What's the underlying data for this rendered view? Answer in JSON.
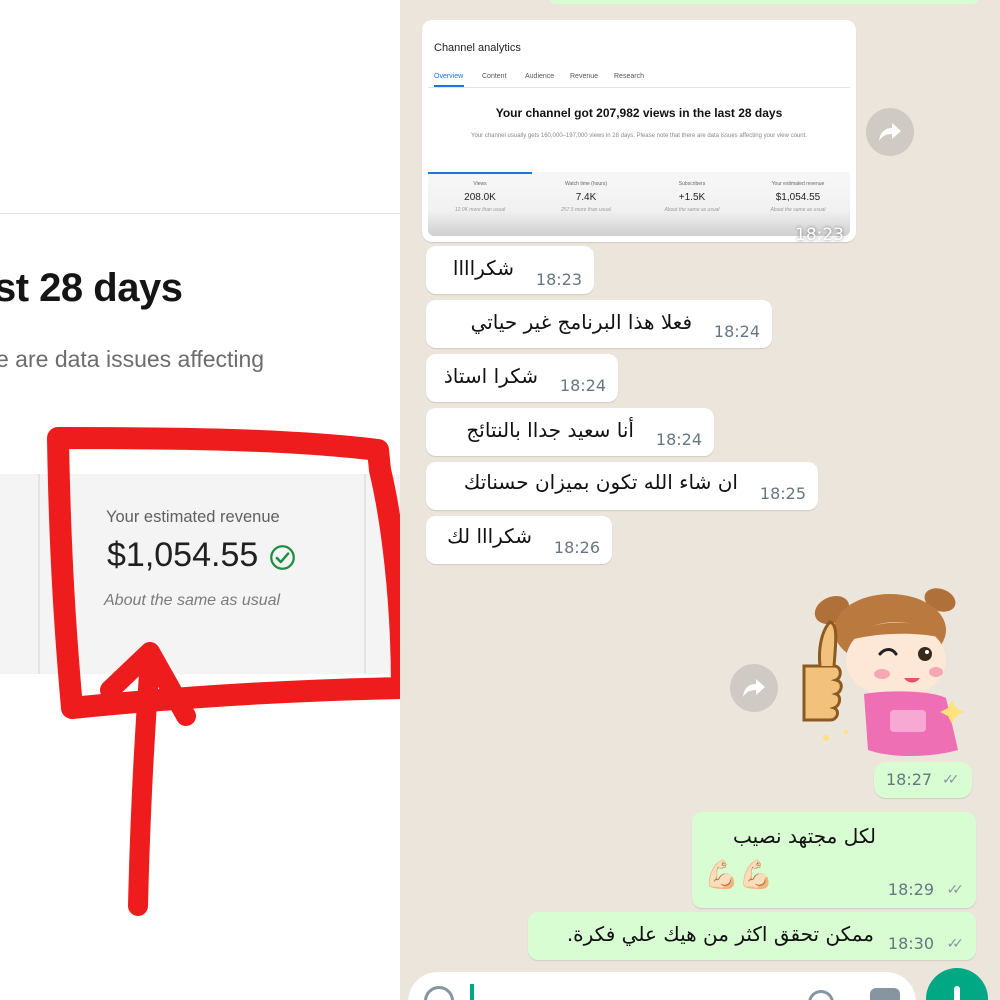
{
  "analytics_zoom": {
    "headline": "st 28 days",
    "subline": "e are data issues affecting",
    "revenue_label": "Your estimated revenue",
    "revenue_value": "$1,054.55",
    "revenue_note": "About the same as usual",
    "check_icon": "check-circle-icon",
    "annotation_color": "#ee1c1c"
  },
  "chat": {
    "wallpaper": "#ece5dc",
    "incoming_color": "#ffffff",
    "outgoing_color": "#d9fdd3",
    "screenshot_message": {
      "time": "18:23",
      "analytics": {
        "title": "Channel analytics",
        "tabs": [
          "Overview",
          "Content",
          "Audience",
          "Revenue",
          "Research"
        ],
        "active_tab": "Overview",
        "headline": "Your channel got 207,982 views in the last 28 days",
        "subline": "Your channel usually gets 160,000–197,000 views in 28 days. Please note that there are data issues affecting your view count.",
        "metrics": [
          {
            "label": "Views",
            "value": "208.0K",
            "note": "12.0K more than usual"
          },
          {
            "label": "Watch time (hours)",
            "value": "7.4K",
            "note": "257.5 more than usual"
          },
          {
            "label": "Subscribers",
            "value": "+1.5K",
            "note": "About the same as usual"
          },
          {
            "label": "Your estimated revenue",
            "value": "$1,054.55",
            "note": "About the same as usual"
          }
        ]
      }
    },
    "messages": [
      {
        "direction": "in",
        "text": "شكراااا",
        "time": "18:23"
      },
      {
        "direction": "in",
        "text": "فعلا هذا البرنامج غير حياتي",
        "time": "18:24"
      },
      {
        "direction": "in",
        "text": "شكرا استاذ",
        "time": "18:24"
      },
      {
        "direction": "in",
        "text": "أنا سعيد جداا بالنتائج",
        "time": "18:24"
      },
      {
        "direction": "in",
        "text": "ان شاء الله تكون بميزان حسناتك",
        "time": "18:25"
      },
      {
        "direction": "in",
        "text": "شكرااا لك",
        "time": "18:26"
      },
      {
        "direction": "out",
        "type": "sticker",
        "sticker": "thumbs-up-girl",
        "time": "18:27",
        "status": "read"
      },
      {
        "direction": "out",
        "text": "لكل مجتهد نصيب",
        "emoji": "💪🏻💪🏻",
        "time": "18:29",
        "status": "read"
      },
      {
        "direction": "out",
        "text": "ممكن تحقق اكثر من هيك علي فكرة.",
        "time": "18:30",
        "status": "read"
      }
    ],
    "icons": {
      "forward": "forward-icon",
      "read_receipt": "double-check-icon",
      "send": "send-button-icon"
    }
  }
}
